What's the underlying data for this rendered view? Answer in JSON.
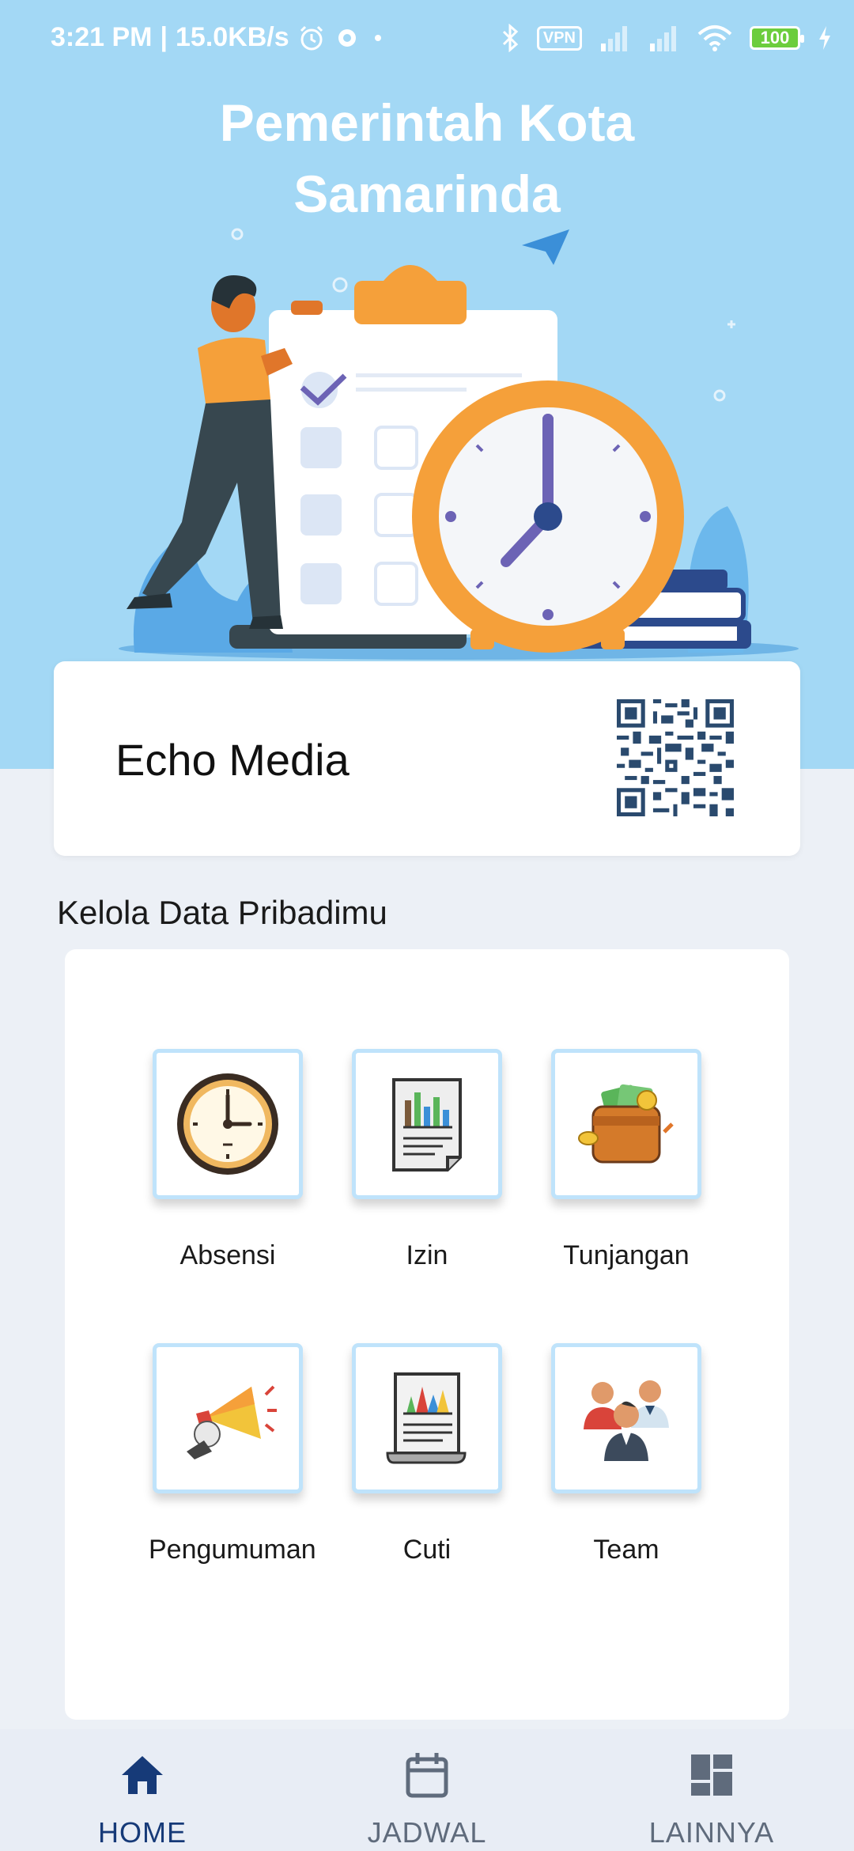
{
  "status_bar": {
    "time": "3:21 PM",
    "speed": "15.0KB/s",
    "vpn": "VPN",
    "battery": "100"
  },
  "hero": {
    "title_line1": "Pemerintah Kota",
    "title_line2": "Samarinda"
  },
  "profile": {
    "name": "Echo Media"
  },
  "section": {
    "title": "Kelola Data Pribadimu"
  },
  "menu": {
    "items": [
      {
        "label": "Absensi",
        "icon": "clock-icon"
      },
      {
        "label": "Izin",
        "icon": "report-document-icon"
      },
      {
        "label": "Tunjangan",
        "icon": "wallet-icon"
      },
      {
        "label": "Pengumuman",
        "icon": "megaphone-icon"
      },
      {
        "label": "Cuti",
        "icon": "chart-paper-icon"
      },
      {
        "label": "Team",
        "icon": "team-icon"
      }
    ]
  },
  "nav": {
    "items": [
      {
        "label": "HOME",
        "icon": "home-icon",
        "active": true
      },
      {
        "label": "JADWAL",
        "icon": "calendar-icon",
        "active": false
      },
      {
        "label": "LAINNYA",
        "icon": "grid-icon",
        "active": false
      }
    ]
  },
  "colors": {
    "hero_bg": "#a3d8f5",
    "page_bg": "#ecf0f6",
    "nav_active": "#163a78",
    "nav_inactive": "#5f6b7c",
    "tile_border": "#bfe3fb",
    "clock_orange": "#f5a03a"
  }
}
